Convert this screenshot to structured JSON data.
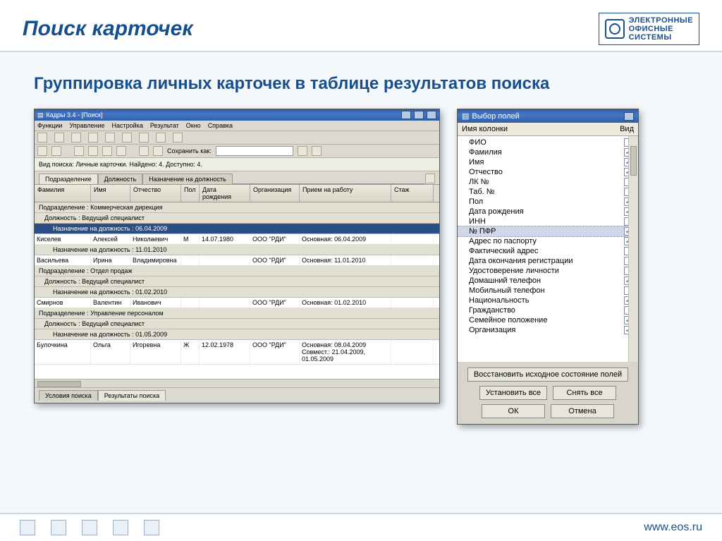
{
  "slide": {
    "title": "Поиск карточек",
    "subtitle": "Группировка личных карточек в таблице результатов поиска",
    "logo_line1": "ЭЛЕКТРОННЫЕ",
    "logo_line2": "ОФИСНЫЕ",
    "logo_line3": "СИСТЕМЫ",
    "footer_url": "www.eos.ru"
  },
  "app": {
    "title": "Кадры 3.4 - [Поиск]",
    "menu": [
      "Функции",
      "Управление",
      "Настройка",
      "Результат",
      "Окно",
      "Справка"
    ],
    "save_as_label": "Сохранить как:",
    "info": "Вид поиска: Личные карточки. Найдено: 4. Доступно: 4.",
    "tabs": [
      "Подразделение",
      "Должность",
      "Назначение на должность"
    ],
    "columns": [
      "Фамилия",
      "Имя",
      "Отчество",
      "Пол",
      "Дата рождения",
      "Организация",
      "Прием на работу",
      "Стаж"
    ],
    "groups": {
      "g1": "Подразделение : Коммерческая дирекция",
      "g1a": "Должность : Ведущий специалист",
      "g1a1": "Назначение на должность : 06.04.2009",
      "r1": {
        "fam": "Киселев",
        "im": "Алексей",
        "ot": "Николаевич",
        "pol": "М",
        "dr": "14.07.1980",
        "org": "ООО \"РДИ\"",
        "pr": "Основная: 06.04.2009"
      },
      "g1a2": "Назначение на должность : 11.01.2010",
      "r2": {
        "fam": "Васильева",
        "im": "Ирина",
        "ot": "Владимировна",
        "pol": "",
        "dr": "",
        "org": "ООО \"РДИ\"",
        "pr": "Основная: 11.01.2010"
      },
      "g2": "Подразделение : Отдел продаж",
      "g2a": "Должность : Ведущий специалист",
      "g2a1": "Назначение на должность : 01.02.2010",
      "r3": {
        "fam": "Смирнов",
        "im": "Валентин",
        "ot": "Иванович",
        "pol": "",
        "dr": "",
        "org": "ООО \"РДИ\"",
        "pr": "Основная: 01.02.2010"
      },
      "g3": "Подразделение : Управление персоналом",
      "g3a": "Должность : Ведущий специалист",
      "g3a1": "Назначение на должность : 01.05.2009",
      "r4": {
        "fam": "Булочкина",
        "im": "Ольга",
        "ot": "Игоревна",
        "pol": "Ж",
        "dr": "12.02.1978",
        "org": "ООО \"РДИ\"",
        "pr": "Основная: 08.04.2009\nСовмест.: 21.04.2009, 01.05.2009"
      }
    },
    "bottom_tabs": [
      "Условия поиска",
      "Результаты поиска"
    ]
  },
  "dialog": {
    "title": "Выбор полей",
    "col_name": "Имя колонки",
    "col_vis": "Вид",
    "fields": [
      {
        "name": "ФИО",
        "on": false
      },
      {
        "name": "Фамилия",
        "on": true
      },
      {
        "name": "Имя",
        "on": true
      },
      {
        "name": "Отчество",
        "on": true
      },
      {
        "name": "ЛК №",
        "on": false
      },
      {
        "name": "Таб. №",
        "on": false
      },
      {
        "name": "Пол",
        "on": true
      },
      {
        "name": "Дата рождения",
        "on": true
      },
      {
        "name": "ИНН",
        "on": false
      },
      {
        "name": "№ ПФР",
        "on": true,
        "sel": true
      },
      {
        "name": "Адрес по паспорту",
        "on": true
      },
      {
        "name": "Фактический адрес",
        "on": false
      },
      {
        "name": "Дата окончания регистрации",
        "on": false
      },
      {
        "name": "Удостоверение личности",
        "on": false
      },
      {
        "name": "Домашний телефон",
        "on": true
      },
      {
        "name": "Мобильный телефон",
        "on": false
      },
      {
        "name": "Национальность",
        "on": true
      },
      {
        "name": "Гражданство",
        "on": false
      },
      {
        "name": "Семейное положение",
        "on": true
      },
      {
        "name": "Организация",
        "on": true
      }
    ],
    "btn_restore": "Восстановить исходное состояние полей",
    "btn_set_all": "Установить все",
    "btn_clear_all": "Снять все",
    "btn_ok": "ОК",
    "btn_cancel": "Отмена"
  }
}
